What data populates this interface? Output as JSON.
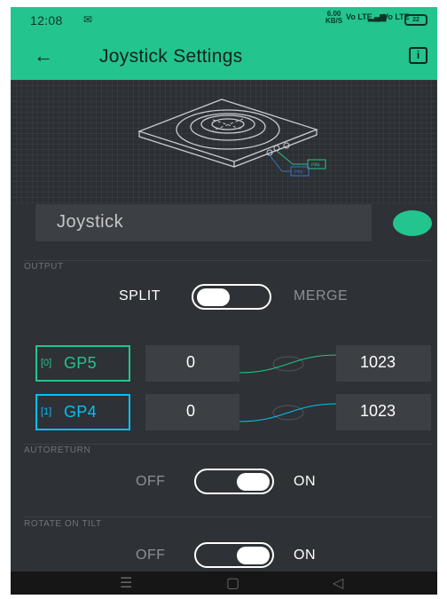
{
  "status_bar": {
    "time": "12:08",
    "notification_icon": "message-icon",
    "speed_value": "6.00",
    "speed_unit": "KB/S",
    "net_label_1": "Vo LTE",
    "net_label_2": "Vo LTE",
    "battery": "22"
  },
  "app_bar": {
    "title": "Joystick Settings",
    "back_icon": "arrow-left-icon",
    "info_icon": "info-icon",
    "info_glyph": "i"
  },
  "diagram": {
    "pin_label_1": "PIN",
    "pin_label_2": "PIN"
  },
  "widget": {
    "name": "Joystick",
    "color": "#23c48e"
  },
  "output": {
    "section_label": "OUTPUT",
    "left_label": "SPLIT",
    "right_label": "MERGE",
    "state": "SPLIT"
  },
  "pins": [
    {
      "index": "[0]",
      "pin": "GP5",
      "min": "0",
      "max": "1023",
      "color": "#23c48e"
    },
    {
      "index": "[1]",
      "pin": "GP4",
      "min": "0",
      "max": "1023",
      "color": "#04c0f8"
    }
  ],
  "autoreturn": {
    "section_label": "AUTORETURN",
    "off_label": "OFF",
    "on_label": "ON",
    "state": "ON"
  },
  "rotate_on_tilt": {
    "section_label": "ROTATE ON TILT",
    "off_label": "OFF",
    "on_label": "ON",
    "state": "ON"
  },
  "nav_bar": {
    "menu_glyph": "☰",
    "home_glyph": "▢",
    "back_glyph": "◁"
  }
}
